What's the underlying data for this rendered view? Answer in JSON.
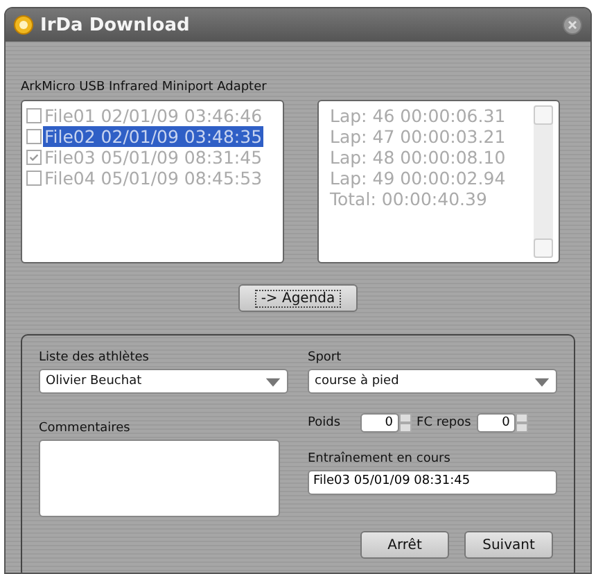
{
  "window": {
    "title": "IrDa Download"
  },
  "adapter_label": "ArkMicro USB Infrared Miniport Adapter",
  "files": [
    {
      "label": "File01 02/01/09 03:46:46",
      "checked": false,
      "selected": false
    },
    {
      "label": "File02 02/01/09 03:48:35",
      "checked": false,
      "selected": true
    },
    {
      "label": "File03 05/01/09 08:31:45",
      "checked": true,
      "selected": false
    },
    {
      "label": "File04 05/01/09 08:45:53",
      "checked": false,
      "selected": false
    }
  ],
  "laps": [
    "Lap: 46 00:00:06.31",
    "Lap: 47 00:00:03.21",
    "Lap: 48 00:00:08.10",
    "Lap: 49 00:00:02.94",
    "Total:  00:00:40.39"
  ],
  "agenda_button": "-> Agenda",
  "athletes": {
    "label": "Liste des athlètes",
    "value": "Olivier Beuchat"
  },
  "sport": {
    "label": "Sport",
    "value": "course à pied"
  },
  "comments": {
    "label": "Commentaires"
  },
  "weight": {
    "label": "Poids",
    "value": "0"
  },
  "rest_hr": {
    "label": "FC repos",
    "value": "0"
  },
  "current_training": {
    "label": "Entraînement en cours",
    "value": "File03 05/01/09 08:31:45"
  },
  "buttons": [
    "Arrêt",
    "Suivant"
  ]
}
